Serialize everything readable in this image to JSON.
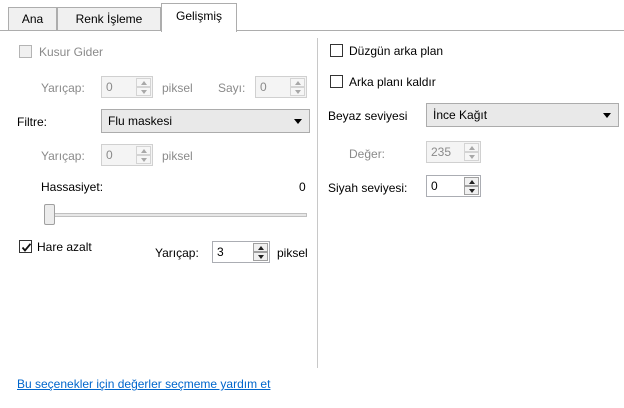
{
  "tabs": [
    {
      "label": "Ana"
    },
    {
      "label": "Renk İşleme"
    },
    {
      "label": "Gelişmiş"
    }
  ],
  "left": {
    "kusur_gider": {
      "label": "Kusur Gider",
      "checked": false,
      "enabled": false
    },
    "yaricap1": {
      "label": "Yarıçap:",
      "value": "0",
      "unit": "piksel"
    },
    "sayi": {
      "label": "Sayı:",
      "value": "0"
    },
    "filtre": {
      "label": "Filtre:",
      "selected": "Flu maskesi"
    },
    "yaricap2": {
      "label": "Yarıçap:",
      "value": "0",
      "unit": "piksel"
    },
    "hassasiyet": {
      "label": "Hassasiyet:",
      "value": "0",
      "level": 0
    },
    "hare_azalt": {
      "label": "Hare azalt",
      "checked": true
    },
    "hare_yaricap": {
      "label": "Yarıçap:",
      "value": "3",
      "unit": "piksel"
    }
  },
  "right": {
    "duzgun_arka_plan": {
      "label": "Düzgün arka plan",
      "checked": false
    },
    "arka_plani_kaldir": {
      "label": "Arka planı kaldır",
      "checked": false
    },
    "beyaz_seviyesi": {
      "label": "Beyaz seviyesi",
      "selected": "İnce Kağıt"
    },
    "deger": {
      "label": "Değer:",
      "value": "235"
    },
    "siyah_seviyesi": {
      "label": "Siyah seviyesi:",
      "value": "0"
    }
  },
  "help_link": "Bu seçenekler için değerler seçmeme yardım et"
}
